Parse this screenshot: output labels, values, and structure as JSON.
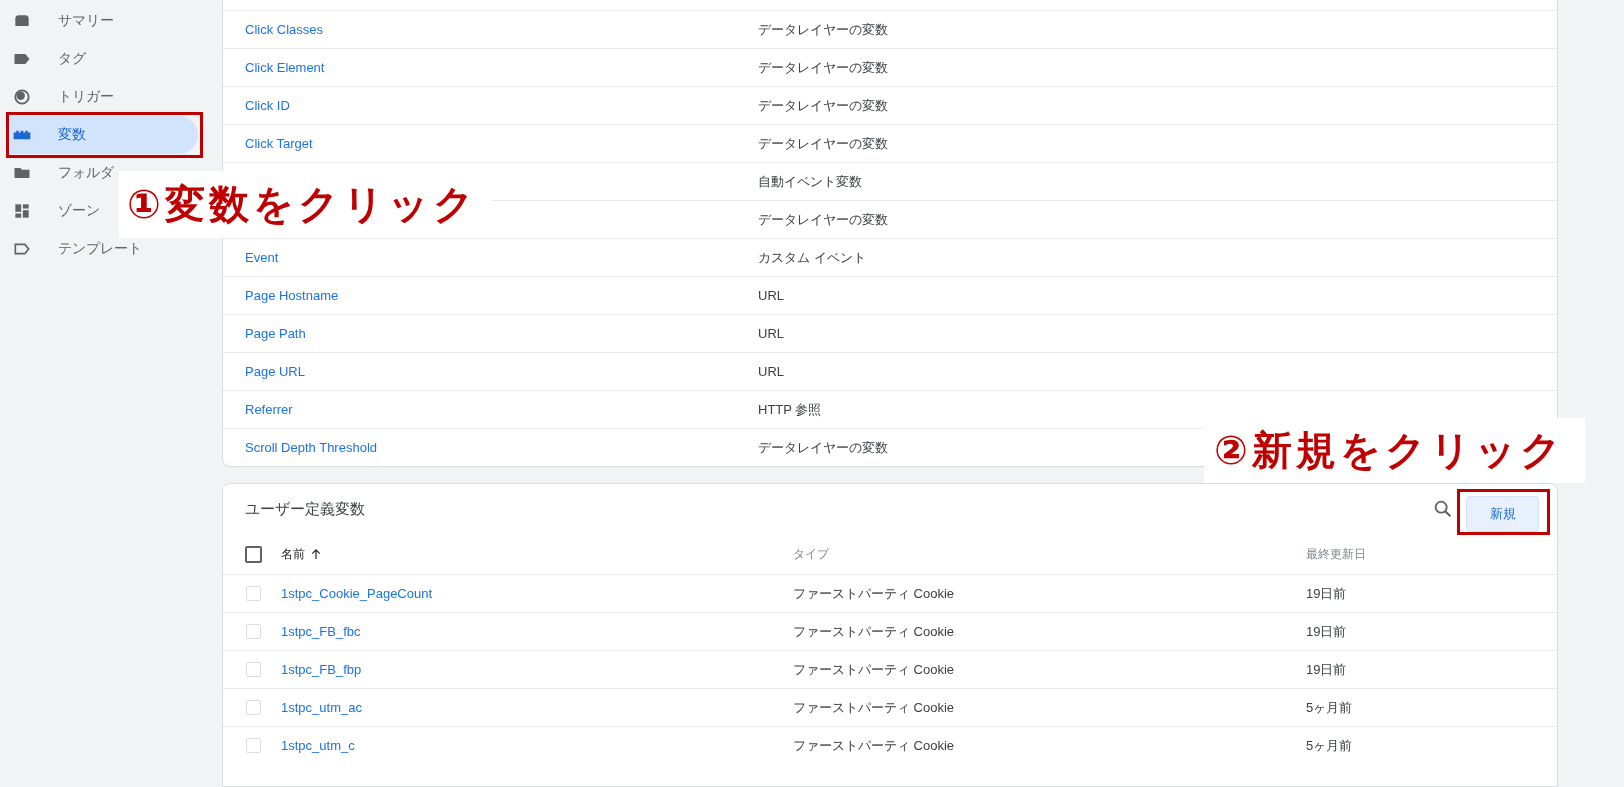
{
  "sidebar": {
    "items": [
      {
        "label": "サマリー",
        "kind": "summary",
        "selected": false
      },
      {
        "label": "タグ",
        "kind": "tag",
        "selected": false
      },
      {
        "label": "トリガー",
        "kind": "trigger",
        "selected": false
      },
      {
        "label": "変数",
        "kind": "variable",
        "selected": true
      },
      {
        "label": "フォルダ",
        "kind": "folder",
        "selected": false
      },
      {
        "label": "ゾーン",
        "kind": "zone",
        "selected": false
      },
      {
        "label": "テンプレート",
        "kind": "template",
        "selected": false
      }
    ]
  },
  "built_in_variables": {
    "rows": [
      {
        "name": "Click Classes",
        "type": "データレイヤーの変数"
      },
      {
        "name": "Click Element",
        "type": "データレイヤーの変数"
      },
      {
        "name": "Click ID",
        "type": "データレイヤーの変数"
      },
      {
        "name": "Click Target",
        "type": "データレイヤーの変数"
      },
      {
        "type": "自動イベント変数"
      },
      {
        "type": "データレイヤーの変数"
      },
      {
        "name": "Event",
        "type": "カスタム イベント"
      },
      {
        "name": "Page Hostname",
        "type": "URL"
      },
      {
        "name": "Page Path",
        "type": "URL"
      },
      {
        "name": "Page URL",
        "type": "URL"
      },
      {
        "name": "Referrer",
        "type": "HTTP 参照"
      },
      {
        "name": "Scroll Depth Threshold",
        "type": "データレイヤーの変数"
      }
    ]
  },
  "user_defined_variables": {
    "title": "ユーザー定義変数",
    "new_button": "新規",
    "select_all": {
      "checked": false
    },
    "columns": [
      "名前",
      "タイプ",
      "最終更新日"
    ],
    "rows": [
      {
        "name": "1stpc_Cookie_PageCount",
        "type": "ファーストパーティ Cookie",
        "updated": "19日前",
        "checked": false
      },
      {
        "name": "1stpc_FB_fbc",
        "type": "ファーストパーティ Cookie",
        "updated": "19日前",
        "checked": false
      },
      {
        "name": "1stpc_FB_fbp",
        "type": "ファーストパーティ Cookie",
        "updated": "19日前",
        "checked": false
      },
      {
        "name": "1stpc_utm_ac",
        "type": "ファーストパーティ Cookie",
        "updated": "5ヶ月前",
        "checked": false
      },
      {
        "name": "1stpc_utm_c",
        "type": "ファーストパーティ Cookie",
        "updated": "5ヶ月前",
        "checked": false
      }
    ]
  },
  "callouts": [
    {
      "text": "①変数をクリック"
    },
    {
      "text": "②新規をクリック"
    }
  ]
}
